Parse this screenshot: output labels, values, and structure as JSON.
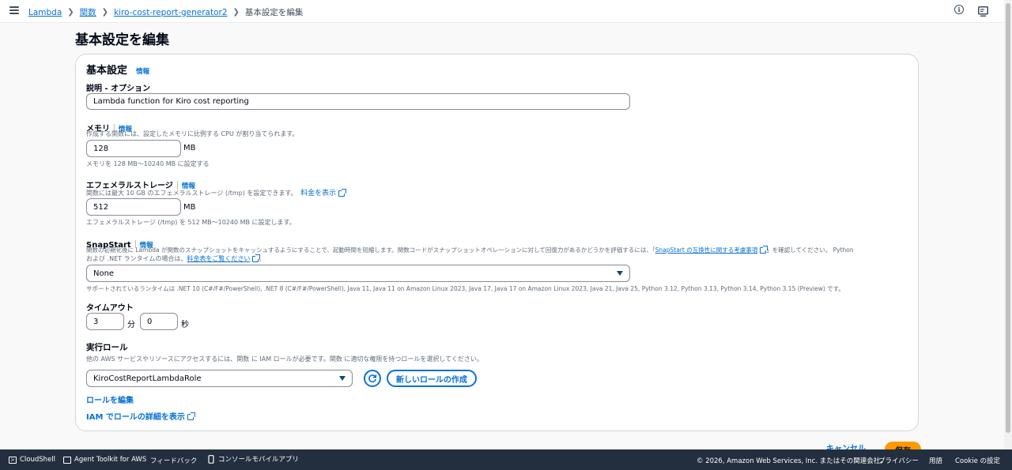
{
  "breadcrumb": {
    "items": [
      "Lambda",
      "関数",
      "kiro-cost-report-generator2"
    ],
    "current": "基本設定を編集"
  },
  "page_title": "基本設定を編集",
  "panel": {
    "title": "基本設定",
    "info": "情報",
    "description": {
      "label": "説明 - オプション",
      "value": "Lambda function for Kiro cost reporting"
    },
    "memory": {
      "label": "メモリ",
      "info": "情報",
      "help": "作成する関数には、設定したメモリに比例する CPU が割り当てられます。",
      "value": "128",
      "unit": "MB",
      "constraint": "メモリを 128 MB〜10240 MB に設定する"
    },
    "ephemeral": {
      "label": "エフェメラルストレージ",
      "info": "情報",
      "help": "関数には最大 10 GB のエフェメラルストレージ (/tmp) を設定できます。",
      "pricing_link": "料金を表示",
      "value": "512",
      "unit": "MB",
      "constraint": "エフェメラルストレージ (/tmp) を 512 MB〜10240 MB に設定します。"
    },
    "snapstart": {
      "label": "SnapStart",
      "info": "情報",
      "help_line1": "関数の初期化後に Lambda が関数のスナップショットをキャッシュするようにすることで、起動時間を短縮します。関数コードがスナップショットオペレーションに対して回復力があるかどうかを評価するには、「",
      "compat_link": "SnapStart の互換性に関する考慮事項",
      "help_line1_end": "」を確認してください。 Python",
      "help_line2": "および .NET ランタイムの場合は、",
      "pricing_link": "料金表をご覧ください",
      "help_line2_end": "。",
      "selected": "None",
      "supported": "サポートされているランタイムは .NET 10 (C#/F#/PowerShell), .NET 8 (C#/F#/PowerShell), Java 11, Java 11 on Amazon Linux 2023, Java 17, Java 17 on Amazon Linux 2023, Java 21, Java 25, Python 3.12, Python 3.13, Python 3.14, Python 3.15 (Preview) です。"
    },
    "timeout": {
      "label": "タイムアウト",
      "minutes": "3",
      "minutes_unit": "分",
      "seconds": "0",
      "seconds_unit": "秒"
    },
    "role": {
      "label": "実行ロール",
      "help": "他の AWS サービスやリソースにアクセスするには、関数 に IAM ロールが必要です。関数 に適切な権限を持つロールを選択してください。",
      "selected": "KiroCostReportLambdaRole",
      "create_button": "新しいロールの作成",
      "edit_link": "ロールを編集",
      "iam_link": "IAM でロールの詳細を表示"
    }
  },
  "actions": {
    "cancel": "キャンセル",
    "save": "保存"
  },
  "footer": {
    "cloudshell": "CloudShell",
    "agent_toolkit": "Agent Toolkit for AWS",
    "feedback": "フィードバック",
    "mobile_app": "コンソールモバイルアプリ",
    "copyright": "© 2026, Amazon Web Services, Inc. またはその関連会社。",
    "privacy": "プライバシー",
    "terms": "用語",
    "cookie": "Cookie の設定"
  },
  "colors": {
    "link": "#0972d3",
    "primary_button": "#ff9900",
    "footer_bg": "#232f3e"
  }
}
